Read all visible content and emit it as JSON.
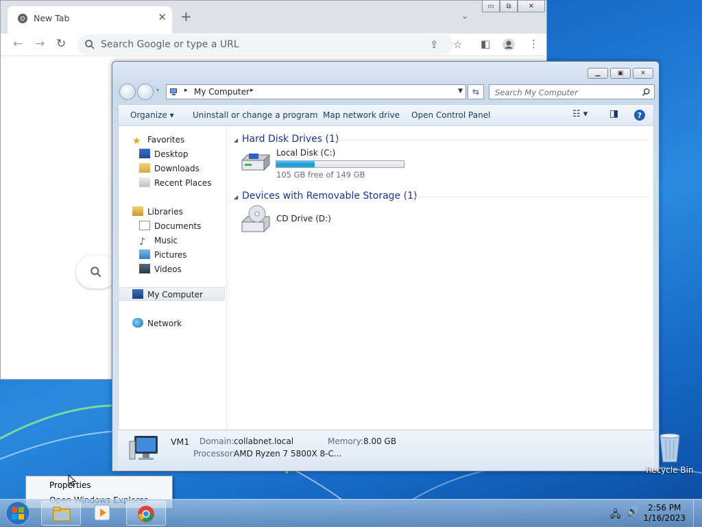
{
  "chrome": {
    "tab_title": "New Tab",
    "tab_close": "✕",
    "new_tab": "+",
    "tab_search": "⌄",
    "omnibox_placeholder": "Search Google or type a URL",
    "window_buttons": [
      "▭",
      "⧉",
      "✕"
    ]
  },
  "explorer": {
    "breadcrumb": "My Computer",
    "search_placeholder": "Search My Computer",
    "commands": [
      "Organize ▾",
      "Uninstall or change a program",
      "Map network drive",
      "Open Control Panel"
    ],
    "nav": {
      "favorites": "Favorites",
      "desktop": "Desktop",
      "downloads": "Downloads",
      "recent": "Recent Places",
      "libraries": "Libraries",
      "documents": "Documents",
      "music": "Music",
      "pictures": "Pictures",
      "videos": "Videos",
      "computer": "My Computer",
      "network": "Network"
    },
    "groups": {
      "hdd_title": "Hard Disk Drives (1)",
      "removable_title": "Devices with Removable Storage (1)"
    },
    "drives": {
      "c_name": "Local Disk (C:)",
      "c_free": "105 GB free of 149 GB",
      "c_used_fraction": 0.3,
      "d_name": "CD Drive (D:)"
    },
    "details": {
      "computer_name": "VM1",
      "domain_label": "Domain:",
      "domain_value": "collabnet.local",
      "memory_label": "Memory:",
      "memory_value": "8.00 GB",
      "processor_label": "Processor:",
      "processor_value": "AMD Ryzen 7 5800X 8-C..."
    }
  },
  "context_menu": {
    "items": [
      "Properties",
      "Open Windows Explorer"
    ]
  },
  "desktop": {
    "recycle_bin": "Recycle Bin"
  },
  "taskbar": {
    "time": "2:56 PM",
    "date": "1/16/2023"
  }
}
